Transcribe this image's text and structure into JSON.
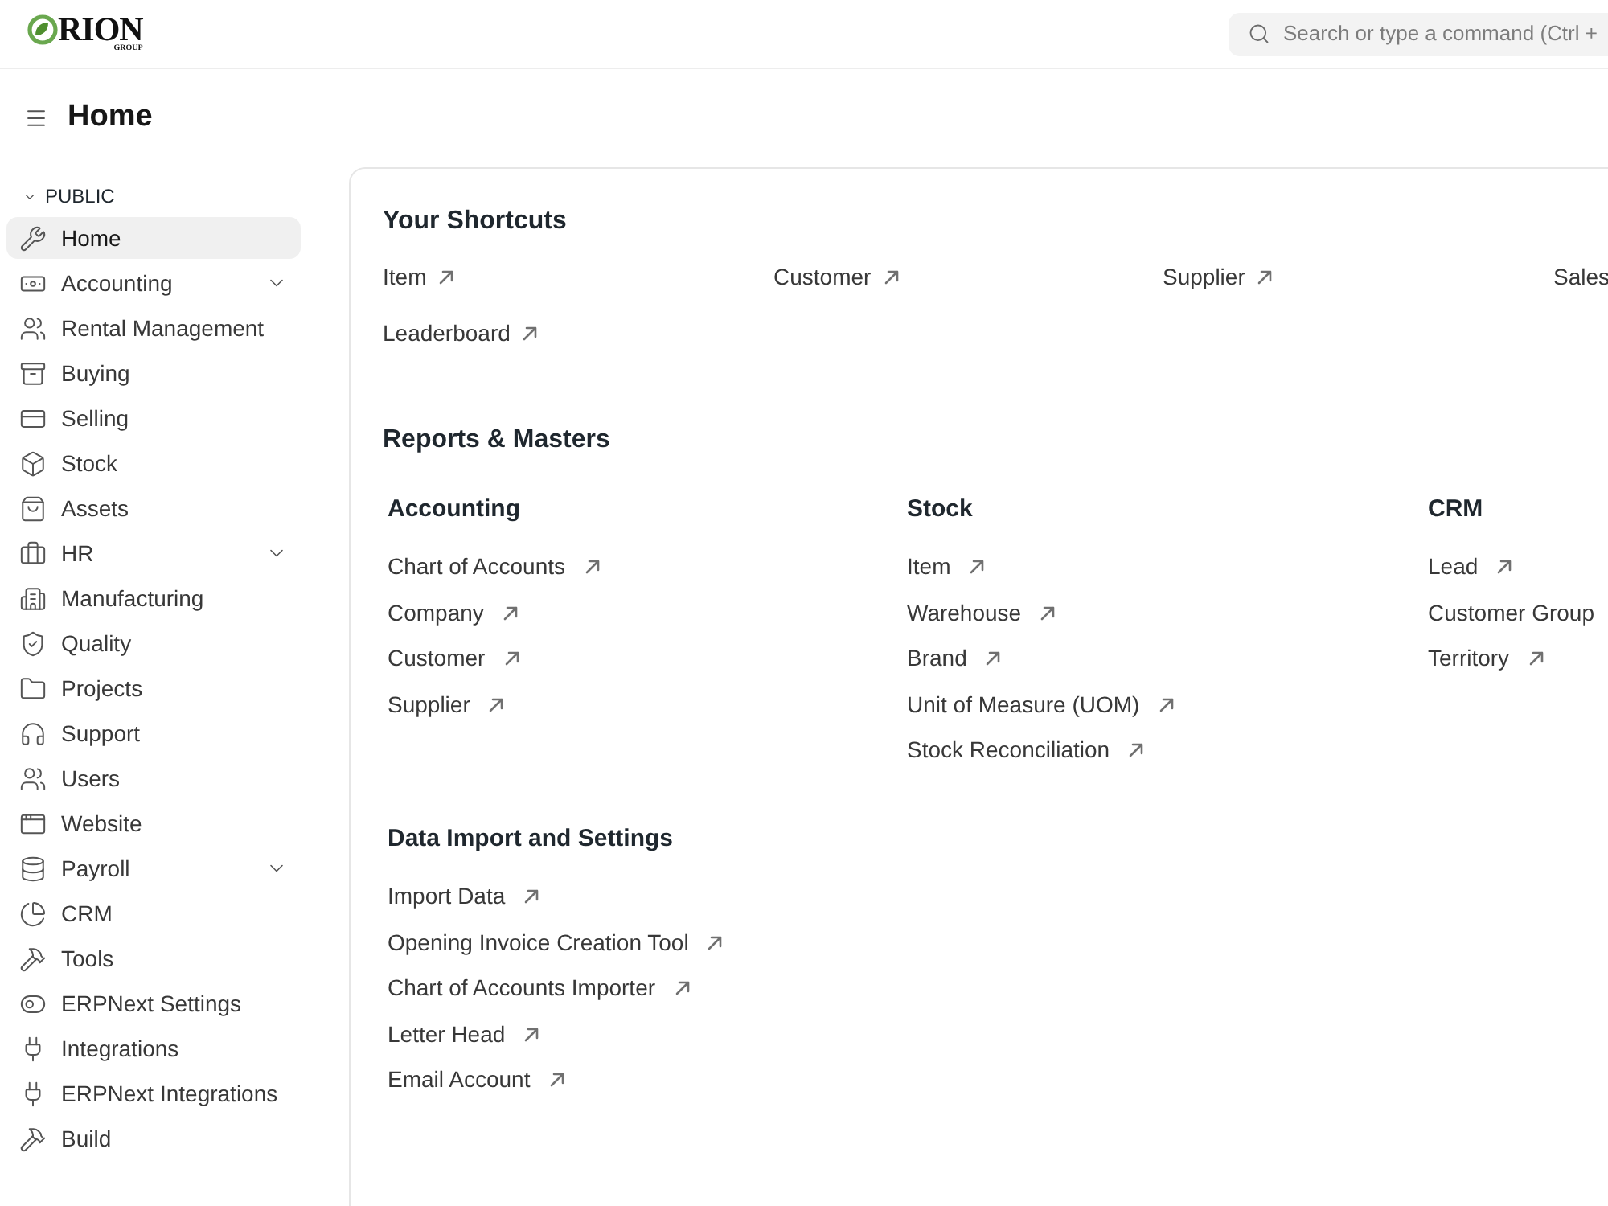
{
  "header": {
    "logo": {
      "wordmark": "RION",
      "tagline": "GROUP"
    },
    "search": {
      "placeholder": "Search or type a command (Ctrl +"
    }
  },
  "page_title": "Home",
  "sidebar": {
    "section": {
      "label": "PUBLIC",
      "expanded": true
    },
    "items": [
      {
        "label": "Home",
        "selected": true,
        "expandable": false
      },
      {
        "label": "Accounting",
        "selected": false,
        "expandable": true
      },
      {
        "label": "Rental Management",
        "selected": false,
        "expandable": false
      },
      {
        "label": "Buying",
        "selected": false,
        "expandable": false
      },
      {
        "label": "Selling",
        "selected": false,
        "expandable": false
      },
      {
        "label": "Stock",
        "selected": false,
        "expandable": false
      },
      {
        "label": "Assets",
        "selected": false,
        "expandable": false
      },
      {
        "label": "HR",
        "selected": false,
        "expandable": true
      },
      {
        "label": "Manufacturing",
        "selected": false,
        "expandable": false
      },
      {
        "label": "Quality",
        "selected": false,
        "expandable": false
      },
      {
        "label": "Projects",
        "selected": false,
        "expandable": false
      },
      {
        "label": "Support",
        "selected": false,
        "expandable": false
      },
      {
        "label": "Users",
        "selected": false,
        "expandable": false
      },
      {
        "label": "Website",
        "selected": false,
        "expandable": false
      },
      {
        "label": "Payroll",
        "selected": false,
        "expandable": true
      },
      {
        "label": "CRM",
        "selected": false,
        "expandable": false
      },
      {
        "label": "Tools",
        "selected": false,
        "expandable": false
      },
      {
        "label": "ERPNext Settings",
        "selected": false,
        "expandable": false
      },
      {
        "label": "Integrations",
        "selected": false,
        "expandable": false
      },
      {
        "label": "ERPNext Integrations",
        "selected": false,
        "expandable": false
      },
      {
        "label": "Build",
        "selected": false,
        "expandable": false
      }
    ]
  },
  "shortcuts": {
    "title": "Your Shortcuts",
    "items": [
      {
        "label": "Item",
        "arrow": true
      },
      {
        "label": "Customer",
        "arrow": true
      },
      {
        "label": "Supplier",
        "arrow": true
      },
      {
        "label": "Sales",
        "arrow": false
      },
      {
        "label": "Leaderboard",
        "arrow": true
      }
    ]
  },
  "reports": {
    "title": "Reports & Masters",
    "groups": [
      {
        "title": "Accounting",
        "links": [
          {
            "label": "Chart of Accounts",
            "arrow": true
          },
          {
            "label": "Company",
            "arrow": true
          },
          {
            "label": "Customer",
            "arrow": true
          },
          {
            "label": "Supplier",
            "arrow": true
          }
        ]
      },
      {
        "title": "Stock",
        "links": [
          {
            "label": "Item",
            "arrow": true
          },
          {
            "label": "Warehouse",
            "arrow": true
          },
          {
            "label": "Brand",
            "arrow": true
          },
          {
            "label": "Unit of Measure (UOM)",
            "arrow": true
          },
          {
            "label": "Stock Reconciliation",
            "arrow": true
          }
        ]
      },
      {
        "title": "CRM",
        "links": [
          {
            "label": "Lead",
            "arrow": true
          },
          {
            "label": "Customer Group",
            "arrow": false
          },
          {
            "label": "Territory",
            "arrow": true
          }
        ]
      },
      {
        "title": "Data Import and Settings",
        "links": [
          {
            "label": "Import Data",
            "arrow": true
          },
          {
            "label": "Opening Invoice Creation Tool",
            "arrow": true
          },
          {
            "label": "Chart of Accounts Importer",
            "arrow": true
          },
          {
            "label": "Letter Head",
            "arrow": true
          },
          {
            "label": "Email Account",
            "arrow": true
          }
        ]
      }
    ]
  }
}
